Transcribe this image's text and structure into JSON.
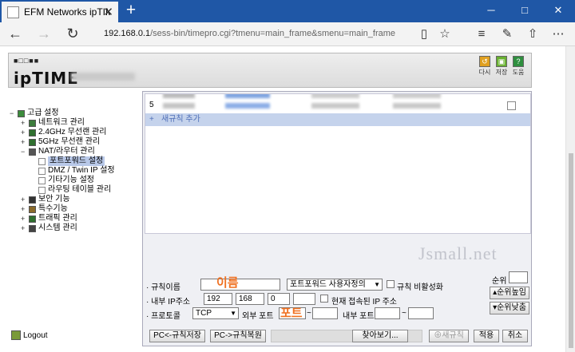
{
  "browser": {
    "tab_title": "EFM Networks ipTIME A",
    "tab_close": "✕",
    "new_tab": "+",
    "url_host": "192.168.0.1",
    "url_path": "/sess-bin/timepro.cgi?tmenu=main_frame&smenu=main_frame",
    "icons": [
      "back-icon",
      "forward-icon",
      "refresh-icon",
      "reading-view-icon",
      "favorite-star-icon",
      "hub-icon",
      "web-note-icon",
      "share-icon",
      "more-icon"
    ]
  },
  "header": {
    "logo_dots": "■□□■■",
    "logo_brand": "ipTIME",
    "icons": [
      {
        "label": "다시",
        "color": "#e0a020"
      },
      {
        "label": "저장",
        "color": "#68b030"
      },
      {
        "label": "도움",
        "color": "#2f8f3f"
      }
    ]
  },
  "tree": {
    "root": {
      "toggle": "−",
      "label": "고급 설정"
    },
    "items": [
      {
        "toggle": "+",
        "label": "네트워크 관리",
        "color": "#3c7c3c"
      },
      {
        "toggle": "+",
        "label": "2.4GHz 무선랜 관리",
        "color": "#2f6f2f"
      },
      {
        "toggle": "+",
        "label": "5GHz 무선랜 관리",
        "color": "#2f6f2f"
      },
      {
        "toggle": "−",
        "label": "NAT/라우터 관리",
        "color": "#555555"
      },
      {
        "toggle": "+",
        "label": "보안 기능",
        "color": "#333333"
      },
      {
        "toggle": "+",
        "label": "특수기능",
        "color": "#8a6a2a"
      },
      {
        "toggle": "+",
        "label": "트래픽 관리",
        "color": "#2f6f2f"
      },
      {
        "toggle": "+",
        "label": "시스템 관리",
        "color": "#444444"
      }
    ],
    "nat_children": [
      "포트포워드 설정",
      "DMZ / Twin IP 설정",
      "기타기능 설정",
      "라우팅 테이블 관리"
    ],
    "selected": "포트포워드 설정",
    "logout_label": "Logout"
  },
  "rules": {
    "visible_row_number": "5",
    "add_rule_label": "새규칙 추가",
    "add_rule_plus": "+"
  },
  "watermark": "Jsmall.net",
  "form": {
    "rule_name_label": "· 규칙이름",
    "rule_name_value": "",
    "annotation_name": "이름",
    "preset_value": "포트포워드 사용자정의",
    "disable_rule_label": "규칙 비활성화",
    "internal_ip_label": "· 내부 IP주소",
    "ip_octets": [
      "192",
      "168",
      "0",
      ""
    ],
    "current_ip_label": "현재 접속된 IP 주소",
    "protocol_label": "· 프로토콜",
    "protocol_value": "TCP",
    "external_port_label": "외부 포트",
    "annotation_port": "포트",
    "internal_port_label": "내부 포트",
    "tilde": "~",
    "priority_label": "순위",
    "priority_up": "순위높임",
    "priority_down": "순위낮춤"
  },
  "bottom_buttons": {
    "save_to_pc": "PC<-규칙저장",
    "restore_from_pc": "PC->규칙복원",
    "browse": "찾아보기...",
    "new_rule": "새규칙",
    "apply": "적용",
    "cancel": "취소"
  }
}
